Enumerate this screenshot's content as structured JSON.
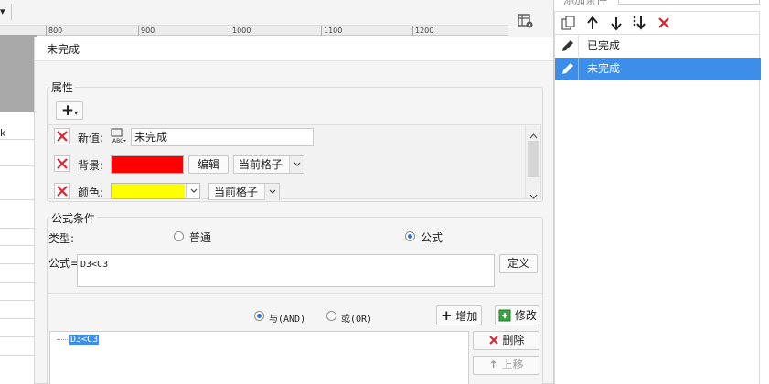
{
  "sheet": {
    "ruler_ticks": [
      "800",
      "900",
      "1000",
      "1100",
      "1200"
    ],
    "cell_text": "k"
  },
  "dialog": {
    "title": "未完成",
    "attributes": {
      "section_label": "属性",
      "add_label": "+",
      "rows": [
        {
          "label": "新值:",
          "value": "未完成"
        },
        {
          "label": "背景:",
          "color": "#ff0000",
          "edit_label": "编辑",
          "scope": "当前格子"
        },
        {
          "label": "颜色:",
          "color": "#ffff00",
          "scope": "当前格子"
        }
      ]
    },
    "formula_condition": {
      "section_label": "公式条件",
      "type_label": "类型:",
      "option_normal": "普通",
      "option_formula": "公式",
      "selected": "公式",
      "formula_label": "公式=",
      "formula_value": "D3<C3",
      "define_label": "定义",
      "and_label": "与(AND)",
      "or_label": "或(OR)",
      "logic_selected": "与(AND)",
      "add_label": "增加",
      "modify_label": "修改",
      "conditions": [
        "D3<C3"
      ],
      "delete_label": "删除",
      "move_up_label": "上移"
    }
  },
  "right_panel": {
    "header_label": "添加条件",
    "items": [
      "已完成",
      "未完成"
    ],
    "selected_index": 1
  },
  "colors": {
    "accent": "#3d8ee8",
    "delete_red": "#d9232e"
  }
}
